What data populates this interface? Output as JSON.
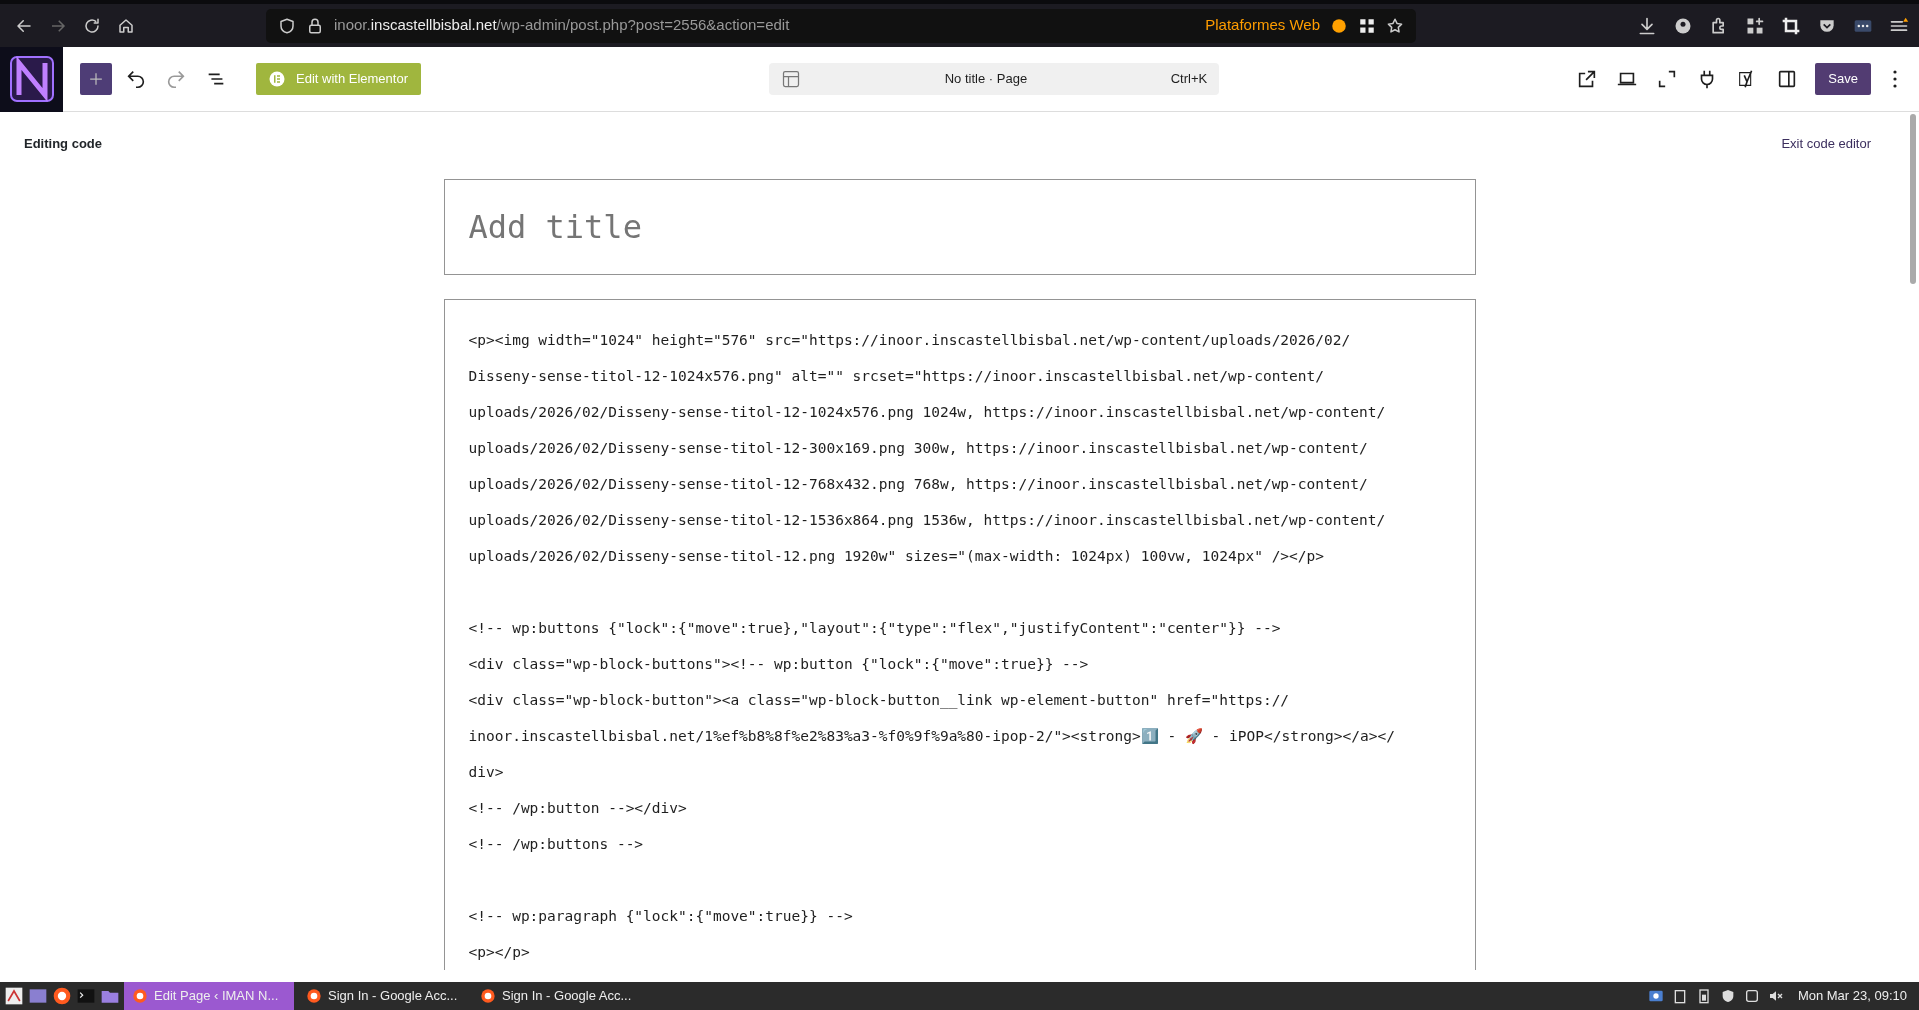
{
  "browser": {
    "url": {
      "subdomain": "inoor.",
      "domain": "inscastellbisbal.net",
      "path": "/wp-admin/post.php?post=2556&action=edit"
    },
    "extension_label": "Plataformes Web"
  },
  "toolbar": {
    "elementor_button": "Edit with Elementor",
    "command": {
      "title": "No title · Page",
      "shortcut": "Ctrl+K"
    },
    "save_button": "Save"
  },
  "editor": {
    "heading": "Editing code",
    "exit_link": "Exit code editor",
    "title_placeholder": "Add title",
    "code_blocks": [
      [
        "<p><img width=\"1024\" height=\"576\" src=\"https://inoor.inscastellbisbal.net/wp-content/uploads/2026/02/",
        "Disseny-sense-titol-12-1024x576.png\" alt=\"\" srcset=\"https://inoor.inscastellbisbal.net/wp-content/",
        "uploads/2026/02/Disseny-sense-titol-12-1024x576.png 1024w, https://inoor.inscastellbisbal.net/wp-content/",
        "uploads/2026/02/Disseny-sense-titol-12-300x169.png 300w, https://inoor.inscastellbisbal.net/wp-content/",
        "uploads/2026/02/Disseny-sense-titol-12-768x432.png 768w, https://inoor.inscastellbisbal.net/wp-content/",
        "uploads/2026/02/Disseny-sense-titol-12-1536x864.png 1536w, https://inoor.inscastellbisbal.net/wp-content/",
        "uploads/2026/02/Disseny-sense-titol-12.png 1920w\" sizes=\"(max-width: 1024px) 100vw, 1024px\" /></p>"
      ],
      [
        "<!-- wp:buttons {\"lock\":{\"move\":true},\"layout\":{\"type\":\"flex\",\"justifyContent\":\"center\"}} -->",
        "<div class=\"wp-block-buttons\"><!-- wp:button {\"lock\":{\"move\":true}} -->",
        "<div class=\"wp-block-button\"><a class=\"wp-block-button__link wp-element-button\" href=\"https://",
        "inoor.inscastellbisbal.net/1%ef%b8%8f%e2%83%a3-%f0%9f%9a%80-ipop-2/\"><strong>1️⃣ - 🚀 - iPOP</strong></a></",
        "div>",
        "<!-- /wp:button --></div>",
        "<!-- /wp:buttons -->"
      ],
      [
        "<!-- wp:paragraph {\"lock\":{\"move\":true}} -->",
        "<p></p>"
      ]
    ]
  },
  "taskbar": {
    "tasks": [
      {
        "label": "Edit Page ‹ IMAN N...",
        "selected": true
      },
      {
        "label": "Sign In - Google Acc...",
        "selected": false
      },
      {
        "label": "Sign In - Google Acc...",
        "selected": false
      }
    ],
    "clock": "Mon Mar 23, 09:10"
  }
}
